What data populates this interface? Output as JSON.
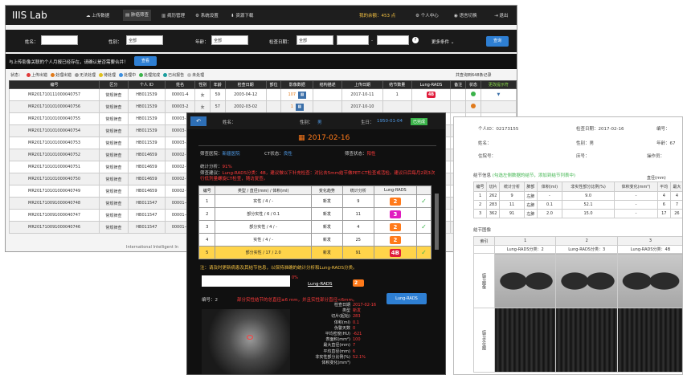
{
  "app": {
    "logo": "IIIS Lab",
    "nav": [
      "上传数据",
      "肺癌筛查",
      "病历管理",
      "系统设置",
      "资源下载"
    ],
    "active_nav": "肺癌筛查",
    "points": "我的余额：453 点",
    "user": "个人中心",
    "lang": "语言切换",
    "logout": "退出"
  },
  "filter": {
    "name_label": "姓名：",
    "sex_label": "性别：",
    "sex_value": "全部",
    "age_label": "年龄：",
    "age_value": "全部",
    "date_label": "检查日期：",
    "date_value": "全部",
    "more": "更多条件",
    "query": "查询"
  },
  "notice": {
    "text": "与上传影像关联的个人月报已经存在，请确认是否需要合并！",
    "button": "查看"
  },
  "status_row": {
    "label": "状态：",
    "legend": [
      {
        "text": "上传出错",
        "color": "#e03b3b"
      },
      {
        "text": "处理出错",
        "color": "#e07a1b"
      },
      {
        "text": "无法处理",
        "color": "#999999"
      },
      {
        "text": "待处理",
        "color": "#e0c01b"
      },
      {
        "text": "处理中",
        "color": "#3b8ee0"
      },
      {
        "text": "处理完成",
        "color": "#3bb34a"
      },
      {
        "text": "已出报告",
        "color": "#1b9e9e"
      },
      {
        "text": "未处理",
        "color": "#bbbbbb"
      }
    ],
    "total": "共查询到648条记录"
  },
  "table": {
    "headers": [
      "编号",
      "区分",
      "个人 ID",
      "姓名",
      "性别",
      "年龄",
      "检查日期",
      "部位",
      "影像数据",
      "结构描述",
      "上传日期",
      "结节数量",
      "Lung-RADS",
      "备注",
      "状态",
      "更改提示符"
    ],
    "rows": [
      {
        "id": "MR201710111000040757",
        "type": "常规筛查",
        "pid": "HB011539",
        "name": "00001-4",
        "sex": "女",
        "age": "59",
        "date": "2003-04-12",
        "count_img": "107",
        "upload": "2017-10-11",
        "nodules": "1",
        "rads": "4B",
        "status_color": "#3bb34a"
      },
      {
        "id": "MR201710101000040756",
        "type": "常规筛查",
        "pid": "HB011539",
        "name": "00003-2",
        "sex": "女",
        "age": "57",
        "date": "2002-03-02",
        "count_img": "1",
        "upload": "2017-10-10",
        "nodules": "",
        "rads": "",
        "status_color": "#e07a1b"
      },
      {
        "id": "MR201710101000040755",
        "type": "常规筛查",
        "pid": "HB011539",
        "name": "00003-2",
        "sex": "",
        "age": "",
        "date": "",
        "count_img": "",
        "upload": "",
        "nodules": "",
        "rads": "",
        "status_color": ""
      },
      {
        "id": "MR201710101000040754",
        "type": "常规筛查",
        "pid": "HB011539",
        "name": "00003-2",
        "sex": "",
        "age": "",
        "date": "",
        "count_img": "",
        "upload": "",
        "nodules": "",
        "rads": "",
        "status_color": ""
      },
      {
        "id": "MR201710101000040753",
        "type": "常规筛查",
        "pid": "HB011539",
        "name": "00003-2",
        "sex": "",
        "age": "",
        "date": "",
        "count_img": "",
        "upload": "",
        "nodules": "",
        "rads": "",
        "status_color": ""
      },
      {
        "id": "MR201710101000040752",
        "type": "常规筛查",
        "pid": "HB014659",
        "name": "00002-7",
        "sex": "",
        "age": "",
        "date": "",
        "count_img": "",
        "upload": "",
        "nodules": "",
        "rads": "",
        "status_color": ""
      },
      {
        "id": "MR201710101000040751",
        "type": "常规筛查",
        "pid": "HB014659",
        "name": "00002-7",
        "sex": "",
        "age": "",
        "date": "",
        "count_img": "",
        "upload": "",
        "nodules": "",
        "rads": "",
        "status_color": ""
      },
      {
        "id": "MR201710101000040750",
        "type": "常规筛查",
        "pid": "HB014659",
        "name": "00002-7",
        "sex": "",
        "age": "",
        "date": "",
        "count_img": "",
        "upload": "",
        "nodules": "",
        "rads": "",
        "status_color": ""
      },
      {
        "id": "MR201710101000040749",
        "type": "常规筛查",
        "pid": "HB014659",
        "name": "00002-7",
        "sex": "",
        "age": "",
        "date": "",
        "count_img": "",
        "upload": "",
        "nodules": "",
        "rads": "",
        "status_color": ""
      },
      {
        "id": "MR201710091000040748",
        "type": "常规筛查",
        "pid": "HB011547",
        "name": "00001-4",
        "sex": "",
        "age": "",
        "date": "",
        "count_img": "",
        "upload": "",
        "nodules": "",
        "rads": "",
        "status_color": ""
      },
      {
        "id": "MR201710091000040747",
        "type": "常规筛查",
        "pid": "HB011547",
        "name": "00001-4",
        "sex": "",
        "age": "",
        "date": "",
        "count_img": "",
        "upload": "",
        "nodules": "",
        "rads": "",
        "status_color": ""
      },
      {
        "id": "MR201710091000040746",
        "type": "常规筛查",
        "pid": "HB011547",
        "name": "00001-4",
        "sex": "",
        "age": "",
        "date": "",
        "count_img": "",
        "upload": "",
        "nodules": "",
        "rads": "",
        "status_color": ""
      }
    ],
    "footer": "International Intelligent In"
  },
  "mid": {
    "name_label": "姓名：",
    "sex_label": "性别：",
    "sex_value": "男",
    "dob_label": "生日：",
    "dob_value": "1950-01-04",
    "tag": "已完成",
    "date": "2017-02-16",
    "hospital_label": "筛查医院：",
    "hospital_value": "新疆医院",
    "ct_label": "CT状态：",
    "ct_value": "良性",
    "rads_label": "筛查状态：",
    "rads_value": "阳性",
    "stat_label": "统计分析：",
    "stat_value": "91%",
    "advice_label": "筛查建议：",
    "advice_text": "Lung-RADS分类：4B，建议做以下补充检查：对比去5mm结节做PET-CT检查或活检。建议日后每月2到3次行低剂量螺旋CT检查，随访复查。",
    "table_headers": [
      "编号",
      "类型 / 直径(mm) / 体积(ml)",
      "变化趋势",
      "统计分析",
      "Lung-RADS"
    ],
    "rows": [
      {
        "n": "1",
        "desc": "实性 / 4 / -",
        "trend": "新发",
        "stat": "9",
        "rads": "2",
        "color": "#ff7a1a",
        "checked": true
      },
      {
        "n": "2",
        "desc": "部分实性 / 6 / 0.1",
        "trend": "新发",
        "stat": "11",
        "rads": "3",
        "color": "#e01bc0",
        "checked": false
      },
      {
        "n": "3",
        "desc": "部分实性 / 4 / -",
        "trend": "新发",
        "stat": "4",
        "rads": "2",
        "color": "#ff7a1a",
        "checked": true
      },
      {
        "n": "4",
        "desc": "实性 / 4 / -",
        "trend": "新发",
        "stat": "25",
        "rads": "2",
        "color": "#ff7a1a",
        "checked": false
      },
      {
        "n": "5",
        "desc": "部分实性 / 17 / 2.0",
        "trend": "新发",
        "stat": "91",
        "rads": "4B",
        "color": "#e01b3b",
        "checked": true
      }
    ],
    "note": "注：请及时更新病患及其结节信息，以保持准确的统计分析和Lung-RADS分类。",
    "detail_top": {
      "label1": "结节分析",
      "val1": "0%",
      "label2": "Lung-RADS",
      "val2": "2"
    },
    "detail_no_label": "编号：2",
    "detail_warn": "部分实性结节的总直径≥6 mm，并且实性部分直径<6mm。",
    "detail_btn": "Lung-RADS",
    "detail_fields": [
      {
        "k": "检查日期",
        "v": "2017-02-16"
      },
      {
        "k": "类型",
        "v": "新发"
      },
      {
        "k": "切片(起始)",
        "v": "283"
      },
      {
        "k": "体积(ml)",
        "v": "0.1"
      },
      {
        "k": "伪警天数",
        "v": "0"
      },
      {
        "k": "平均密度(HU)",
        "v": "-621"
      },
      {
        "k": "表面积(mm²)",
        "v": "100"
      },
      {
        "k": "最大直径(mm)",
        "v": "7"
      },
      {
        "k": "平均直径(mm)",
        "v": "6"
      },
      {
        "k": "非实性部分比例(%)",
        "v": "52.1%"
      },
      {
        "k": "体积变化(mm³)",
        "v": ""
      }
    ]
  },
  "right": {
    "pid_label": "个人ID：02173155",
    "date_label": "检查日期：2017-02-16",
    "no_label": "编号：",
    "name_label": "姓名：",
    "sex_label": "性别：男",
    "age_label": "年龄：67",
    "hosp_label": "住院号：",
    "bed_label": "床号：",
    "op_label": "操作员：",
    "section": "结节信息",
    "section_hint": "(勾选左侧数据的结节，添加到结节列表中)",
    "headers": [
      "编号",
      "切片",
      "统计分析",
      "肺部",
      "体积(ml)",
      "非实性部分比例(%)",
      "体积变化(mm³)",
      "平均",
      "最大"
    ],
    "diam_header": "直径(mm)",
    "rows": [
      {
        "n": "1",
        "slice": "262",
        "stat": "9",
        "side": "左肺",
        "vol": "-",
        "ratio": "9.0",
        "change": "-",
        "avg": "4",
        "max": "4"
      },
      {
        "n": "2",
        "slice": "283",
        "stat": "11",
        "side": "右肺",
        "vol": "0.1",
        "ratio": "52.1",
        "change": "-",
        "avg": "6",
        "max": "7"
      },
      {
        "n": "3",
        "slice": "362",
        "stat": "91",
        "side": "左肺",
        "vol": "2.0",
        "ratio": "15.0",
        "change": "-",
        "avg": "17",
        "max": "26"
      }
    ],
    "img_section": "结节图像",
    "img_headers": [
      "索引",
      "1",
      "2",
      "3"
    ],
    "img_rads": [
      "Lung-RADS分类：2",
      "Lung-RADS分类：3",
      "Lung-RADS分类：4B"
    ],
    "row_label_1": "结节图像",
    "row_label_2": "结节定位图"
  }
}
